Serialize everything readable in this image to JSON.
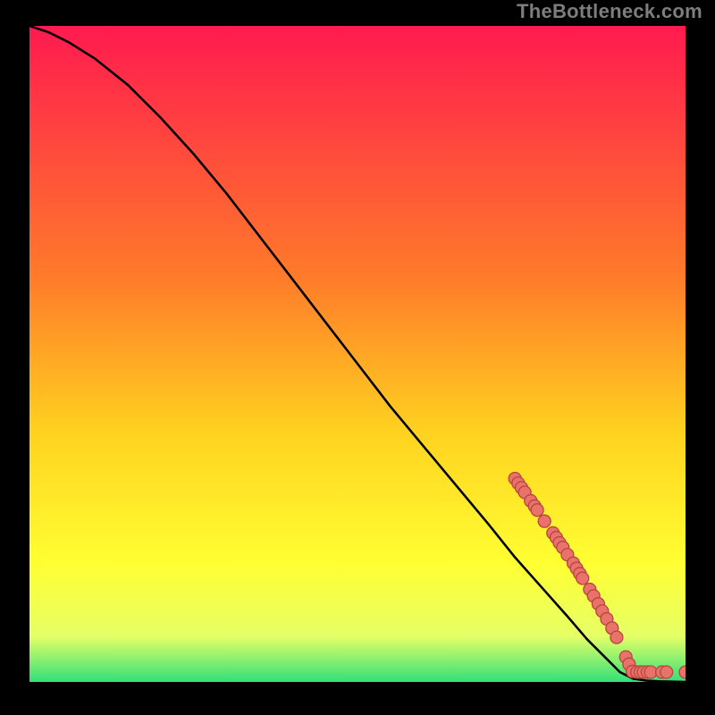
{
  "watermark": "TheBottleneck.com",
  "colors": {
    "frame_bg": "#000000",
    "grad_top": "#ff1a4f",
    "grad_mid1": "#ff7a2a",
    "grad_mid2": "#ffd21f",
    "grad_mid3": "#ffff33",
    "grad_mid4": "#e6ff66",
    "grad_bottom": "#33e07a",
    "curve": "#000000",
    "marker_fill": "#e9736b",
    "marker_stroke": "#b8463f"
  },
  "chart_data": {
    "type": "line",
    "title": "",
    "xlabel": "",
    "ylabel": "",
    "xlim": [
      0,
      100
    ],
    "ylim": [
      0,
      100
    ],
    "grid": false,
    "series": [
      {
        "name": "bottleneck-curve",
        "x": [
          0,
          3,
          6,
          10,
          15,
          20,
          25,
          30,
          35,
          40,
          45,
          50,
          55,
          60,
          65,
          70,
          74,
          78,
          82,
          85,
          88,
          90,
          92,
          94,
          96,
          98,
          100
        ],
        "y": [
          100,
          99,
          97.5,
          95,
          91,
          86,
          80.5,
          74.5,
          68,
          61.5,
          55,
          48.5,
          42,
          36,
          30,
          24,
          19,
          14.5,
          10,
          6.5,
          3.5,
          1.5,
          0.5,
          0.2,
          0.1,
          0.05,
          0.0
        ]
      }
    ],
    "markers": [
      {
        "x": 74.0,
        "y": 31.0
      },
      {
        "x": 74.5,
        "y": 30.3
      },
      {
        "x": 75.0,
        "y": 29.6
      },
      {
        "x": 75.5,
        "y": 28.9
      },
      {
        "x": 76.4,
        "y": 27.6
      },
      {
        "x": 77.0,
        "y": 26.8
      },
      {
        "x": 77.4,
        "y": 26.2
      },
      {
        "x": 78.5,
        "y": 24.5
      },
      {
        "x": 79.8,
        "y": 22.7
      },
      {
        "x": 80.3,
        "y": 22.0
      },
      {
        "x": 80.8,
        "y": 21.2
      },
      {
        "x": 81.3,
        "y": 20.5
      },
      {
        "x": 82.0,
        "y": 19.4
      },
      {
        "x": 82.9,
        "y": 18.1
      },
      {
        "x": 83.4,
        "y": 17.3
      },
      {
        "x": 83.9,
        "y": 16.5
      },
      {
        "x": 84.3,
        "y": 15.8
      },
      {
        "x": 85.4,
        "y": 14.1
      },
      {
        "x": 86.0,
        "y": 13.1
      },
      {
        "x": 86.7,
        "y": 11.9
      },
      {
        "x": 87.3,
        "y": 10.8
      },
      {
        "x": 88.0,
        "y": 9.6
      },
      {
        "x": 88.8,
        "y": 8.2
      },
      {
        "x": 89.5,
        "y": 6.8
      },
      {
        "x": 90.9,
        "y": 3.8
      },
      {
        "x": 91.4,
        "y": 2.7
      },
      {
        "x": 91.9,
        "y": 1.6
      },
      {
        "x": 92.6,
        "y": 1.5
      },
      {
        "x": 93.1,
        "y": 1.5
      },
      {
        "x": 93.6,
        "y": 1.5
      },
      {
        "x": 94.2,
        "y": 1.5
      },
      {
        "x": 94.7,
        "y": 1.5
      },
      {
        "x": 96.4,
        "y": 1.5
      },
      {
        "x": 97.1,
        "y": 1.5
      },
      {
        "x": 100.0,
        "y": 1.5
      }
    ]
  }
}
